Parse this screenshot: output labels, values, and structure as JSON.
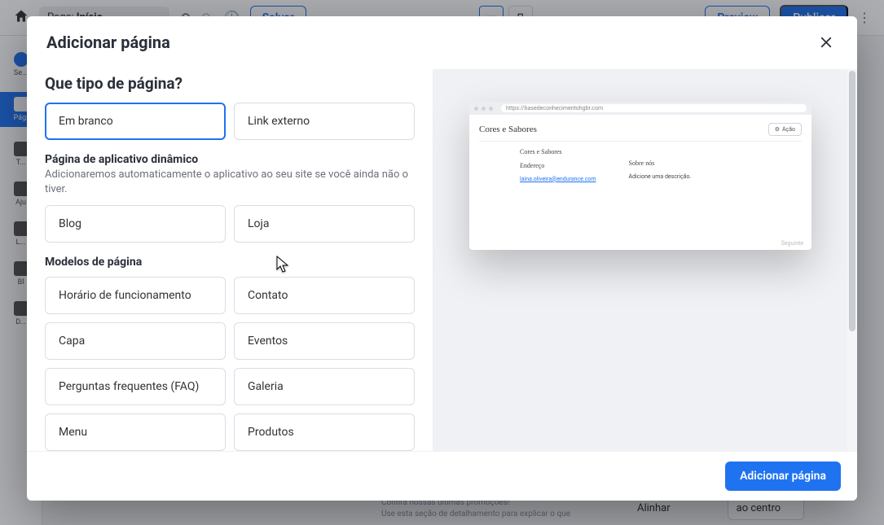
{
  "background": {
    "page_label": "Page:",
    "page_value": "Início",
    "save": "Salvar",
    "preview": "Preview",
    "publish": "Publicar",
    "rail": [
      "Se...",
      "Pági",
      "T...",
      "Aju",
      "L...",
      "Bl",
      "D..."
    ],
    "align_label": "Alinhar",
    "align_value": "ao centro",
    "mid_lines": [
      "Confira nossas últimas promoções!",
      "Use esta seção de detalhamento para explicar o que"
    ]
  },
  "modal": {
    "title": "Adicionar página",
    "question": "Que tipo de página?",
    "types": [
      {
        "label": "Em branco",
        "selected": true
      },
      {
        "label": "Link externo",
        "selected": false
      }
    ],
    "dynamic_heading": "Página de aplicativo dinâmico",
    "dynamic_desc": "Adicionaremos automaticamente o aplicativo ao seu site se você ainda não o tiver.",
    "dynamic_apps": [
      "Blog",
      "Loja"
    ],
    "templates_heading": "Modelos de página",
    "templates": [
      "Horário de funcionamento",
      "Contato",
      "Capa",
      "Eventos",
      "Perguntas frequentes (FAQ)",
      "Galeria",
      "Menu",
      "Produtos"
    ],
    "submit": "Adicionar página"
  },
  "preview": {
    "url": "https://basedeconhecimentohgbr.com",
    "brand": "Cores e Sabores",
    "action": "Ação",
    "brand_small": "Cores e Sabores",
    "col1_label": "Endereço",
    "col1_link": "laina.oliveira@endurance.com",
    "col2_label": "Sobre nós",
    "col2_text": "Adicione uma descrição.",
    "footer": "Seguinte"
  }
}
